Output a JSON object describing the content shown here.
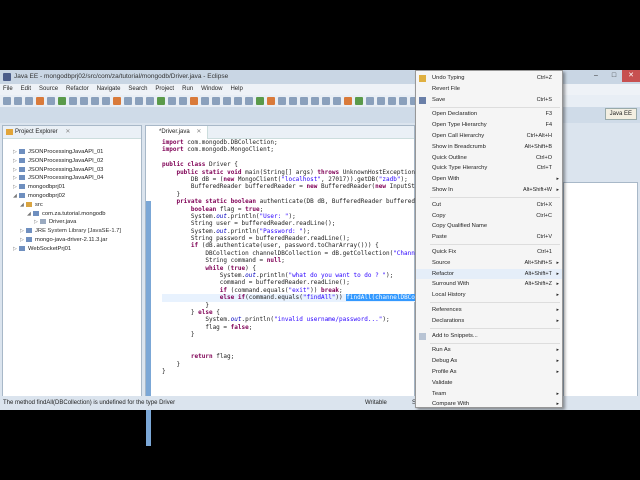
{
  "window": {
    "title": "Java EE - mongodbprj02/src/com/za/tutorial/mongodb/Driver.java - Eclipse",
    "minimize": "–",
    "maximize": "□",
    "close": "✕"
  },
  "menubar": [
    "File",
    "Edit",
    "Source",
    "Refactor",
    "Navigate",
    "Search",
    "Project",
    "Run",
    "Window",
    "Help"
  ],
  "perspective": "Java EE",
  "explorer": {
    "title": "Project Explorer",
    "close": "✕",
    "items": [
      {
        "label": "JSONProcessingJavaAPI_01",
        "depth": 0,
        "twisty": "▷"
      },
      {
        "label": "JSONProcessingJavaAPI_02",
        "depth": 0,
        "twisty": "▷"
      },
      {
        "label": "JSONProcessingJavaAPI_03",
        "depth": 0,
        "twisty": "▷"
      },
      {
        "label": "JSONProcessingJavaAPI_04",
        "depth": 0,
        "twisty": "▷"
      },
      {
        "label": "mongodbprj01",
        "depth": 0,
        "twisty": "▷"
      },
      {
        "label": "mongodbprj02",
        "depth": 0,
        "twisty": "◢"
      },
      {
        "label": "src",
        "depth": 1,
        "twisty": "◢"
      },
      {
        "label": "com.za.tutorial.mongodb",
        "depth": 2,
        "twisty": "◢"
      },
      {
        "label": "Driver.java",
        "depth": 3,
        "twisty": "▷"
      },
      {
        "label": "JRE System Library [JavaSE-1.7]",
        "depth": 1,
        "twisty": "▷"
      },
      {
        "label": "mongo-java-driver-2.11.3.jar",
        "depth": 1,
        "twisty": "▷"
      },
      {
        "label": "WebSocketPrj01",
        "depth": 0,
        "twisty": "▷"
      }
    ]
  },
  "editor": {
    "tab": "*Driver.java",
    "tab_close": "✕",
    "lines": [
      "import com.mongodb.DBCollection;",
      "import com.mongodb.MongoClient;",
      "",
      "public class Driver {",
      "    public static void main(String[] args) throws UnknownHostException {",
      "        DB dB = (new MongoClient(\"localhost\", 27017)).getDB(\"zadb\");",
      "        BufferedReader bufferedReader = new BufferedReader(new InputStream",
      "    }",
      "    private static boolean authenticate(DB dB, BufferedReader bufferedRead",
      "        boolean flag = true;",
      "        System.out.println(\"User: \");",
      "        String user = bufferedReader.readLine();",
      "        System.out.println(\"Password: \");",
      "        String password = bufferedReader.readLine();",
      "        if (dB.authenticate(user, password.toCharArray())) {",
      "            DBCollection channelDBCollection = dB.getCollection(\"Channel\")",
      "            String command = null;",
      "            while (true) {",
      "                System.out.println(\"what do you want to do ? \");",
      "                command = bufferedReader.readLine();",
      "                if (command.equals(\"exit\")) break;",
      "                else if(command.equals(\"findAll\")) ",
      "            }",
      "        } else {",
      "            System.out.println(\"invalid username/password...\");",
      "            flag = false;",
      "        }",
      "",
      "",
      "        return flag;",
      "    }",
      "}"
    ],
    "selection": "findAll(channelDBCollection"
  },
  "status": {
    "message": "The method findAll(DBCollection) is undefined for the type Driver",
    "mode": "Writable",
    "insert": "Sm"
  },
  "context_menu": [
    {
      "label": "Undo Typing",
      "shortcut": "Ctrl+Z",
      "icon": "undo-icon"
    },
    {
      "label": "Revert File"
    },
    {
      "label": "Save",
      "shortcut": "Ctrl+S",
      "icon": "save-icon"
    },
    {
      "sep": true
    },
    {
      "label": "Open Declaration",
      "shortcut": "F3"
    },
    {
      "label": "Open Type Hierarchy",
      "shortcut": "F4"
    },
    {
      "label": "Open Call Hierarchy",
      "shortcut": "Ctrl+Alt+H"
    },
    {
      "label": "Show in Breadcrumb",
      "shortcut": "Alt+Shift+B"
    },
    {
      "label": "Quick Outline",
      "shortcut": "Ctrl+O"
    },
    {
      "label": "Quick Type Hierarchy",
      "shortcut": "Ctrl+T"
    },
    {
      "label": "Open With",
      "submenu": true
    },
    {
      "label": "Show In",
      "shortcut": "Alt+Shift+W",
      "submenu": true
    },
    {
      "sep": true
    },
    {
      "label": "Cut",
      "shortcut": "Ctrl+X"
    },
    {
      "label": "Copy",
      "shortcut": "Ctrl+C"
    },
    {
      "label": "Copy Qualified Name"
    },
    {
      "label": "Paste",
      "shortcut": "Ctrl+V"
    },
    {
      "sep": true
    },
    {
      "label": "Quick Fix",
      "shortcut": "Ctrl+1"
    },
    {
      "label": "Source",
      "shortcut": "Alt+Shift+S",
      "submenu": true
    },
    {
      "label": "Refactor",
      "shortcut": "Alt+Shift+T",
      "submenu": true,
      "highlight": true
    },
    {
      "label": "Surround With",
      "shortcut": "Alt+Shift+Z",
      "submenu": true
    },
    {
      "label": "Local History",
      "submenu": true
    },
    {
      "sep": true
    },
    {
      "label": "References",
      "submenu": true
    },
    {
      "label": "Declarations",
      "submenu": true
    },
    {
      "sep": true
    },
    {
      "label": "Add to Snippets...",
      "icon": "snippet-icon"
    },
    {
      "sep": true
    },
    {
      "label": "Run As",
      "submenu": true
    },
    {
      "label": "Debug As",
      "submenu": true
    },
    {
      "label": "Profile As",
      "submenu": true
    },
    {
      "label": "Validate"
    },
    {
      "label": "Team",
      "submenu": true
    },
    {
      "label": "Compare With",
      "submenu": true
    }
  ],
  "submenu_arrow": "▸"
}
